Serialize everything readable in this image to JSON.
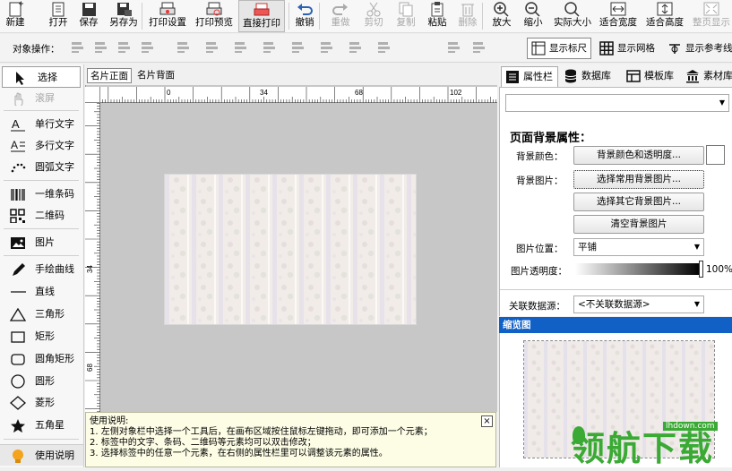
{
  "toolbar": {
    "items": [
      {
        "label": "新建",
        "icon": "new-file-icon",
        "disabled": false
      },
      {
        "label": "打开",
        "icon": "open-file-icon",
        "disabled": false
      },
      {
        "label": "保存",
        "icon": "save-icon",
        "disabled": false
      },
      {
        "label": "另存为",
        "icon": "save-as-icon",
        "disabled": false
      },
      {
        "label": "打印设置",
        "icon": "print-settings-icon",
        "disabled": false
      },
      {
        "label": "打印预览",
        "icon": "print-preview-icon",
        "disabled": false
      },
      {
        "label": "直接打印",
        "icon": "print-icon",
        "disabled": false
      },
      {
        "label": "撤销",
        "icon": "undo-icon",
        "disabled": false
      },
      {
        "label": "重做",
        "icon": "redo-icon",
        "disabled": true
      },
      {
        "label": "剪切",
        "icon": "cut-icon",
        "disabled": true
      },
      {
        "label": "复制",
        "icon": "copy-icon",
        "disabled": true
      },
      {
        "label": "粘贴",
        "icon": "paste-icon",
        "disabled": false
      },
      {
        "label": "删除",
        "icon": "delete-icon",
        "disabled": true
      },
      {
        "label": "放大",
        "icon": "zoom-in-icon",
        "disabled": false
      },
      {
        "label": "缩小",
        "icon": "zoom-out-icon",
        "disabled": false
      },
      {
        "label": "实际大小",
        "icon": "actual-size-icon",
        "disabled": false
      },
      {
        "label": "适合宽度",
        "icon": "fit-width-icon",
        "disabled": false
      },
      {
        "label": "适合高度",
        "icon": "fit-height-icon",
        "disabled": false
      },
      {
        "label": "整页显示",
        "icon": "fit-page-icon",
        "disabled": true
      }
    ]
  },
  "object_ops": {
    "label": "对象操作：",
    "toggles": [
      {
        "label": "显示标尺",
        "icon": "ruler-icon",
        "active": true
      },
      {
        "label": "显示网格",
        "icon": "grid-icon",
        "active": false
      },
      {
        "label": "显示参考线",
        "icon": "guideline-icon",
        "active": false
      }
    ]
  },
  "tools": [
    {
      "label": "选择",
      "icon": "cursor-arrow-icon",
      "selected": true
    },
    {
      "label": "滚屏",
      "icon": "hand-pan-icon",
      "disabled": true
    },
    {
      "label": "单行文字",
      "icon": "single-line-text-icon"
    },
    {
      "label": "多行文字",
      "icon": "multi-line-text-icon"
    },
    {
      "label": "圆弧文字",
      "icon": "arc-text-icon"
    },
    {
      "label": "一维条码",
      "icon": "barcode-icon"
    },
    {
      "label": "二维码",
      "icon": "qrcode-icon"
    },
    {
      "label": "图片",
      "icon": "image-icon"
    },
    {
      "label": "手绘曲线",
      "icon": "pen-icon"
    },
    {
      "label": "直线",
      "icon": "line-icon"
    },
    {
      "label": "三角形",
      "icon": "triangle-icon"
    },
    {
      "label": "矩形",
      "icon": "rectangle-icon"
    },
    {
      "label": "圆角矩形",
      "icon": "rounded-rectangle-icon"
    },
    {
      "label": "圆形",
      "icon": "circle-icon"
    },
    {
      "label": "菱形",
      "icon": "diamond-icon"
    },
    {
      "label": "五角星",
      "icon": "star-icon"
    },
    {
      "label": "使用说明",
      "icon": "lightbulb-icon"
    }
  ],
  "canvas": {
    "tabs": [
      {
        "label": "名片正面",
        "active": true
      },
      {
        "label": "名片背面",
        "active": false
      }
    ],
    "ruler_h": [
      "0",
      "34",
      "68",
      "102"
    ],
    "ruler_v": [
      "34",
      "68"
    ]
  },
  "help": {
    "title": "使用说明:",
    "lines": [
      "1. 左侧对象栏中选择一个工具后，在画布区域按住鼠标左键拖动，即可添加一个元素；",
      "2. 标签中的文字、条码、二维码等元素均可以双击修改；",
      "3. 选择标签中的任意一个元素，在右侧的属性栏里可以调整该元素的属性。"
    ],
    "close": "×"
  },
  "right_tabs": [
    {
      "label": "属性栏",
      "icon": "properties-icon",
      "active": true
    },
    {
      "label": "数据库",
      "icon": "database-icon",
      "active": false
    },
    {
      "label": "模板库",
      "icon": "template-icon",
      "active": false
    },
    {
      "label": "素材库",
      "icon": "material-icon",
      "active": false
    }
  ],
  "properties": {
    "object_select": "",
    "heading": "页面背景属性：",
    "bg_color_label": "背景颜色：",
    "bg_color_button": "背景颜色和透明度...",
    "bg_image_label": "背景图片：",
    "choose_common": "选择常用背景图片...",
    "choose_other": "选择其它背景图片...",
    "clear_bg": "清空背景图片",
    "position_label": "图片位置：",
    "position_value": "平铺",
    "opacity_label": "图片透明度：",
    "opacity_value": "100%",
    "datasource_label": "关联数据源：",
    "datasource_value": "<不关联数据源>"
  },
  "thumbnail": {
    "title": "缩览图"
  },
  "watermark": {
    "text": "领航下载",
    "url": "lhdown.com"
  },
  "colors": {
    "accent": "#1160c6",
    "watermark": "#3aaa35"
  }
}
